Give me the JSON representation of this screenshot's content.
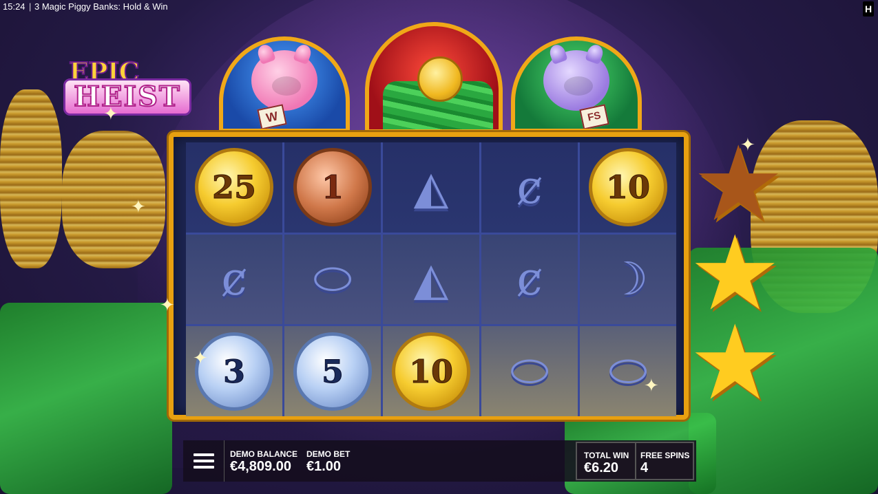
{
  "status_bar": {
    "time": "15:24",
    "separator": "|",
    "game_title": "3 Magic Piggy Banks: Hold & Win",
    "brand_icon": "H"
  },
  "logo": {
    "line1": "EPIC",
    "line2": "HEIST"
  },
  "arches": [
    {
      "theme": "pink-pig",
      "badge": "W"
    },
    {
      "theme": "coin-cash"
    },
    {
      "theme": "purple-pig",
      "badge": "FS"
    }
  ],
  "reels": [
    [
      {
        "type": "coin",
        "variant": "gold",
        "value": "25"
      },
      {
        "type": "coin",
        "variant": "bronze",
        "value": "1"
      },
      {
        "type": "symbol",
        "name": "watermelon-slice-icon",
        "glyph": "◭"
      },
      {
        "type": "symbol",
        "name": "fish-bone-icon",
        "glyph": "ȼ"
      },
      {
        "type": "coin",
        "variant": "gold",
        "value": "10"
      }
    ],
    [
      {
        "type": "symbol",
        "name": "fish-bone-icon",
        "glyph": "ȼ"
      },
      {
        "type": "symbol",
        "name": "tin-can-icon",
        "glyph": "⬭"
      },
      {
        "type": "symbol",
        "name": "watermelon-slice-icon",
        "glyph": "◭"
      },
      {
        "type": "symbol",
        "name": "fish-bone-icon",
        "glyph": "ȼ"
      },
      {
        "type": "symbol",
        "name": "apple-core-icon",
        "glyph": "☽"
      }
    ],
    [
      {
        "type": "coin",
        "variant": "silver",
        "value": "3"
      },
      {
        "type": "coin",
        "variant": "silver",
        "value": "5"
      },
      {
        "type": "coin",
        "variant": "gold",
        "value": "10"
      },
      {
        "type": "symbol",
        "name": "tin-can-icon",
        "glyph": "⬭"
      },
      {
        "type": "symbol",
        "name": "tin-can-icon",
        "glyph": "⬭"
      }
    ]
  ],
  "side_stars": {
    "lit": 2,
    "total": 3
  },
  "hud": {
    "menu_icon": "hamburger-menu-icon",
    "balance_label": "DEMO BALANCE",
    "balance_value": "€4,809.00",
    "bet_label": "DEMO BET",
    "bet_value": "€1.00",
    "total_win_label": "TOTAL WIN",
    "total_win_value": "€6.20",
    "free_spins_label": "FREE SPINS",
    "free_spins_value": "4"
  },
  "colors": {
    "frame": "#e8a010",
    "reel_bg": "#1c2450",
    "gold": "#f6cc30",
    "star": "#ffcc20"
  }
}
